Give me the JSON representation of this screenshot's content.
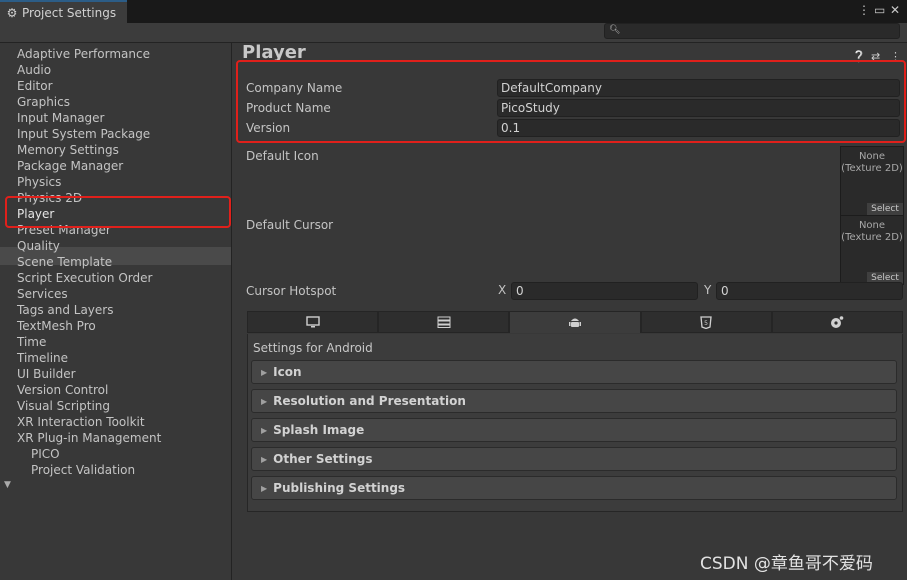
{
  "window": {
    "tab_title": "Project Settings",
    "controls": [
      "⋮",
      "▭",
      "✕"
    ]
  },
  "sidebar": {
    "items": [
      {
        "label": "Adaptive Performance"
      },
      {
        "label": "Audio"
      },
      {
        "label": "Editor"
      },
      {
        "label": "Graphics"
      },
      {
        "label": "Input Manager"
      },
      {
        "label": "Input System Package"
      },
      {
        "label": "Memory Settings"
      },
      {
        "label": "Package Manager"
      },
      {
        "label": "Physics"
      },
      {
        "label": "Physics 2D"
      },
      {
        "label": "Player",
        "selected": true
      },
      {
        "label": "Preset Manager"
      },
      {
        "label": "Quality"
      },
      {
        "label": "Scene Template"
      },
      {
        "label": "Script Execution Order"
      },
      {
        "label": "Services"
      },
      {
        "label": "Tags and Layers"
      },
      {
        "label": "TextMesh Pro"
      },
      {
        "label": "Time"
      },
      {
        "label": "Timeline"
      },
      {
        "label": "UI Builder"
      },
      {
        "label": "Version Control"
      },
      {
        "label": "Visual Scripting"
      },
      {
        "label": "XR Interaction Toolkit"
      },
      {
        "label": "XR Plug-in Management"
      }
    ],
    "sub_items": [
      {
        "label": "PICO"
      },
      {
        "label": "Project Validation"
      }
    ]
  },
  "main": {
    "title": "Player",
    "company_name": {
      "label": "Company Name",
      "value": "DefaultCompany"
    },
    "product_name": {
      "label": "Product Name",
      "value": "PicoStudy"
    },
    "version": {
      "label": "Version",
      "value": "0.1"
    },
    "default_icon": {
      "label": "Default Icon",
      "none": "None",
      "type": "(Texture 2D)",
      "select": "Select"
    },
    "default_cursor": {
      "label": "Default Cursor",
      "none": "None",
      "type": "(Texture 2D)",
      "select": "Select"
    },
    "cursor_hotspot": {
      "label": "Cursor Hotspot",
      "x_label": "X",
      "x_value": "0",
      "y_label": "Y",
      "y_value": "0"
    },
    "platform_tabs": [
      {
        "icon": "monitor-icon"
      },
      {
        "icon": "server-icon"
      },
      {
        "icon": "android-icon",
        "active": true
      },
      {
        "icon": "html5-icon"
      },
      {
        "icon": "disc-icon"
      }
    ],
    "settings_for": "Settings for Android",
    "sections": [
      {
        "label": "Icon"
      },
      {
        "label": "Resolution and Presentation"
      },
      {
        "label": "Splash Image"
      },
      {
        "label": "Other Settings"
      },
      {
        "label": "Publishing Settings"
      }
    ]
  },
  "watermark": "CSDN @章鱼哥不爱码",
  "colors": {
    "highlight_box": "#e0201b",
    "background": "#383838"
  }
}
